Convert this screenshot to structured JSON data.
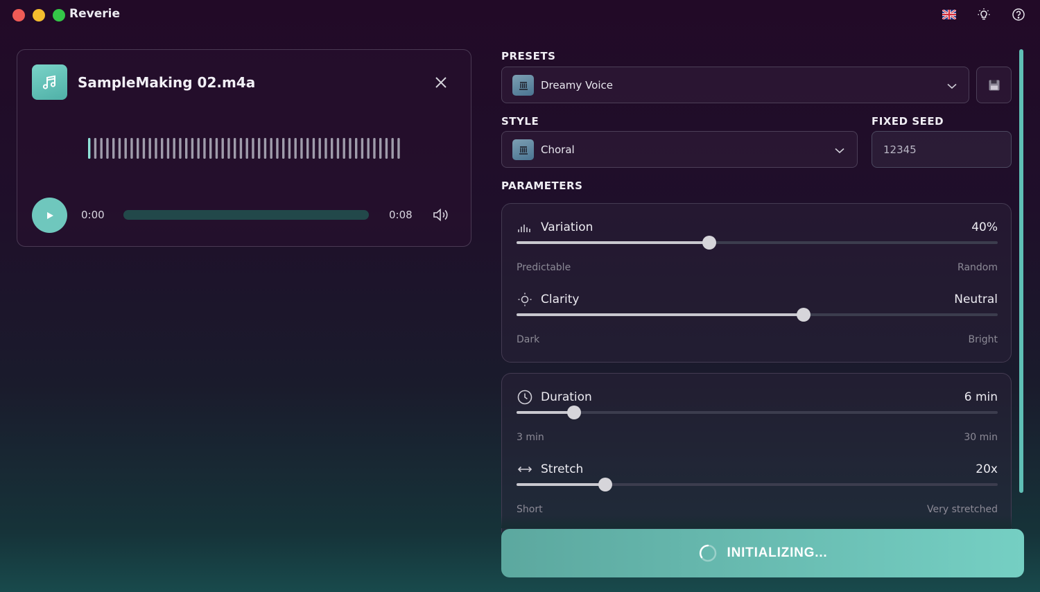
{
  "app": {
    "title": "Reverie"
  },
  "titlebar_icons": [
    "uk-flag-icon",
    "lightbulb-icon",
    "help-icon"
  ],
  "player": {
    "file_name": "SampleMaking 02.m4a",
    "current_time": "0:00",
    "total_time": "0:08",
    "progress": 0.0,
    "waveform_bar_count": 52
  },
  "presets": {
    "label": "PRESETS",
    "selected": "Dreamy Voice"
  },
  "style": {
    "label": "STYLE",
    "selected": "Choral"
  },
  "seed": {
    "label": "FIXED SEED",
    "value": "12345"
  },
  "parameters": {
    "label": "PARAMETERS",
    "variation": {
      "name": "Variation",
      "value": "40%",
      "level": 0.4,
      "min_label": "Predictable",
      "max_label": "Random"
    },
    "clarity": {
      "name": "Clarity",
      "value": "Neutral",
      "level": 0.597,
      "min_label": "Dark",
      "max_label": "Bright"
    },
    "duration": {
      "name": "Duration",
      "value": "6 min",
      "level": 0.12,
      "min_label": "3 min",
      "max_label": "30 min"
    },
    "stretch": {
      "name": "Stretch",
      "value": "20x",
      "level": 0.184,
      "min_label": "Short",
      "max_label": "Very stretched"
    }
  },
  "action": {
    "label": "INITIALIZING..."
  },
  "colors": {
    "accent": "#6fc7bd",
    "background_top": "#220a27",
    "background_bottom": "#184a4c"
  }
}
